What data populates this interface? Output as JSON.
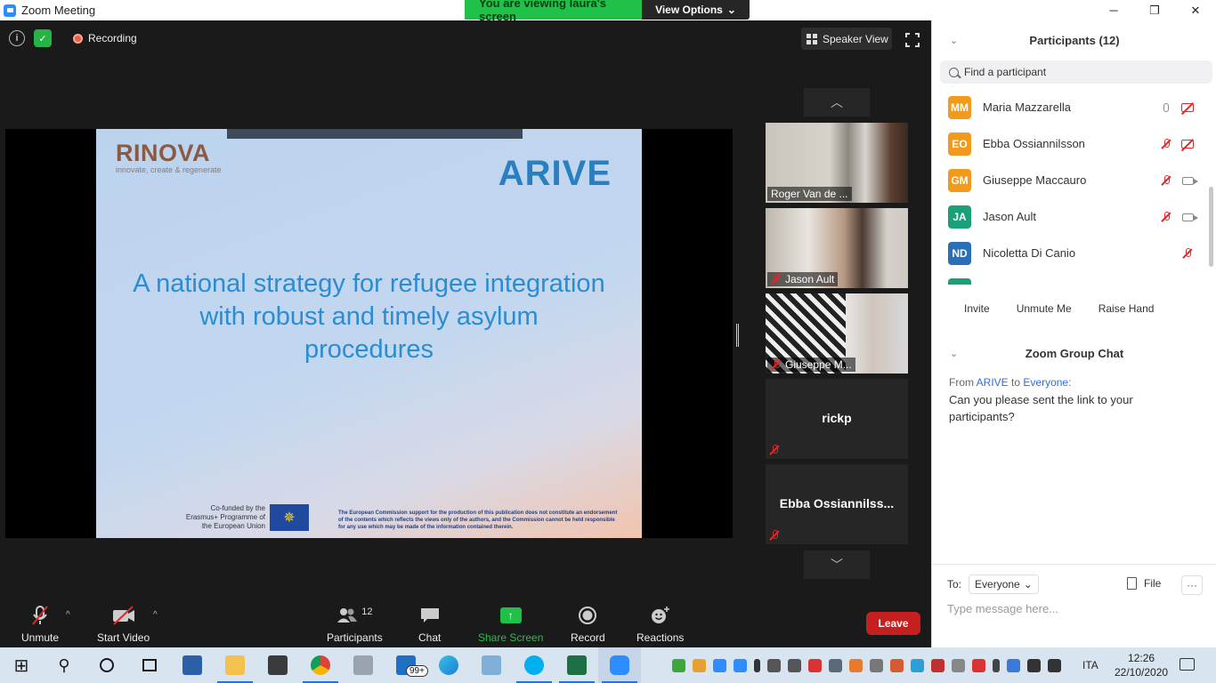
{
  "window": {
    "title": "Zoom Meeting",
    "minimize": "─",
    "maximize": "❐",
    "close": "✕"
  },
  "banner": {
    "viewing": "You are viewing laura's screen",
    "view_options": "View Options",
    "chevron": "⌄"
  },
  "topbar": {
    "info_glyph": "i",
    "shield_glyph": "✓",
    "recording": "Recording",
    "speaker_view": "Speaker View"
  },
  "slide": {
    "logo_name": "RINOVA",
    "logo_tagline": "innovate, create & regenerate",
    "logo_right": "ARIVE",
    "title": "A national strategy for refugee integration with robust and timely asylum procedures",
    "cofunded": "Co-funded by the Erasmus+ Programme of the European Union",
    "eu_stars": "✵",
    "disclaimer": "The European Commission support for the production of this publication does not constitute an endorsement of the contents which reflects the views only of the authors, and the Commission cannot be held responsible for any use which may be made of the information contained therein."
  },
  "thumbnails": {
    "up": "︿",
    "down": "﹀",
    "items": [
      {
        "label": "Roger Van de ...",
        "muted": false
      },
      {
        "label": "Jason Ault",
        "muted": true
      },
      {
        "label": "Giuseppe M...",
        "muted": true
      },
      {
        "label": "rickp",
        "muted": true
      },
      {
        "label": "Ebba  Ossiannilss...",
        "muted": true
      }
    ]
  },
  "toolbar": {
    "unmute": "Unmute",
    "start_video": "Start Video",
    "participants": "Participants",
    "participants_count": "12",
    "chat": "Chat",
    "share_screen": "Share Screen",
    "record": "Record",
    "reactions": "Reactions",
    "leave": "Leave",
    "caret": "^",
    "share_glyph": "↑"
  },
  "panel": {
    "collapse_glyph": "⌄",
    "title": "Participants (12)",
    "search_placeholder": "Find a participant",
    "participants": [
      {
        "initials": "MM",
        "name": "Maria Mazzarella",
        "color": "#f19a1c"
      },
      {
        "initials": "EO",
        "name": "Ebba Ossiannilsson",
        "color": "#f19a1c"
      },
      {
        "initials": "GM",
        "name": "Giuseppe Maccauro",
        "color": "#f19a1c"
      },
      {
        "initials": "JA",
        "name": "Jason Ault",
        "color": "#1aa078"
      },
      {
        "initials": "ND",
        "name": "Nicoletta Di Canio",
        "color": "#2a6fb8"
      }
    ],
    "buttons": {
      "invite": "Invite",
      "unmute_me": "Unmute Me",
      "raise_hand": "Raise Hand"
    }
  },
  "chat": {
    "title": "Zoom Group Chat",
    "from_prefix": "From",
    "from_name": "ARIVE",
    "to_word": "to",
    "to_name": "Everyone:",
    "message": "Can you please sent the link to your participants?",
    "to_label": "To:",
    "recipient": "Everyone",
    "file": "File",
    "more": "···",
    "input_placeholder": "Type message here..."
  },
  "taskbar": {
    "badge": "99+",
    "language": "ITA",
    "time": "12:26",
    "date": "22/10/2020",
    "start_glyph": "⊞",
    "search_glyph": "⚲"
  },
  "colors": {
    "zoom_blue": "#2d8cff",
    "green": "#21c048",
    "leave_red": "#c61f1f",
    "mute_red": "#e02828"
  }
}
